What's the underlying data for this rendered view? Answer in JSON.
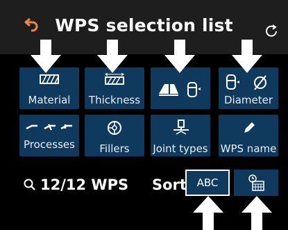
{
  "header": {
    "title": "WPS selection list",
    "back_icon": "undo-arrow-icon",
    "refresh_icon": "refresh-icon"
  },
  "filters": [
    {
      "label": "Material",
      "icon": "material-icon"
    },
    {
      "label": "Thickness",
      "icon": "thickness-icon"
    },
    {
      "label": "",
      "icon": "joint-shape-icon"
    },
    {
      "label": "Diameter",
      "icon": "diameter-icon"
    },
    {
      "label": "Processes",
      "icon": "processes-icon"
    },
    {
      "label": "Fillers",
      "icon": "filler-wire-icon"
    },
    {
      "label": "Joint types",
      "icon": "joint-types-icon"
    },
    {
      "label": "WPS name",
      "icon": "pencil-icon"
    }
  ],
  "status": {
    "count_text": "12/12 WPS",
    "sort_label": "Sort",
    "sort_abc_label": "ABC"
  },
  "colors": {
    "tile": "#0f3a5e",
    "header": "#1e1e1e",
    "accent": "#f0883a"
  }
}
